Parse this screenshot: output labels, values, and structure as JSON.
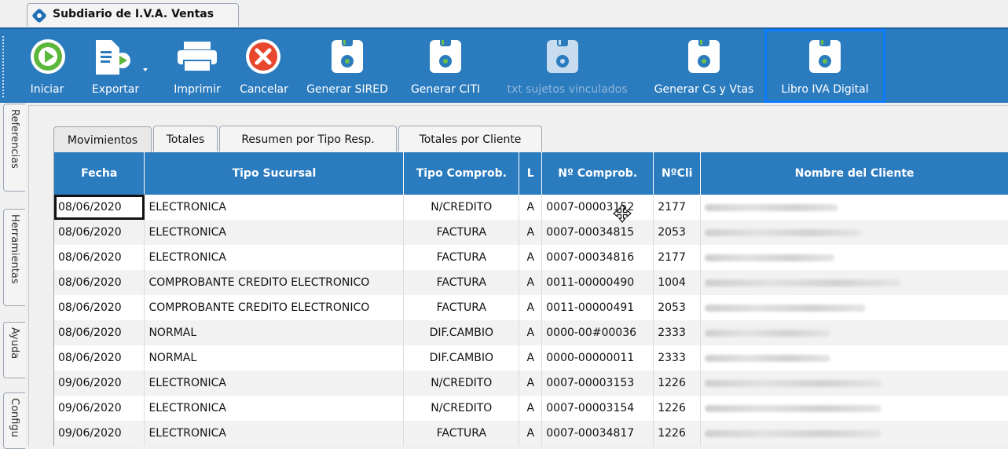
{
  "window": {
    "title": "Subdiario de I.V.A. Ventas"
  },
  "toolbar": {
    "iniciar": "Iniciar",
    "exportar": "Exportar",
    "imprimir": "Imprimir",
    "cancelar": "Cancelar",
    "generar_sired": "Generar SIRED",
    "generar_citi": "Generar CITI",
    "txt_sujetos": "txt sujetos vinculados",
    "generar_cs_vtas": "Generar Cs y Vtas",
    "libro_iva": "Libro IVA Digital"
  },
  "side_tabs": [
    "Referencias",
    "Herramientas",
    "Ayuda",
    "Configu"
  ],
  "tabs": [
    "Movimientos",
    "Totales",
    "Resumen por Tipo Resp.",
    "Totales por Cliente"
  ],
  "grid": {
    "columns": [
      "Fecha",
      "Tipo Sucursal",
      "Tipo Comprob.",
      "L",
      "Nº Comprob.",
      "NºCli",
      "Nombre del Cliente"
    ],
    "rows": [
      {
        "fecha": "08/06/2020",
        "sucursal": "ELECTRONICA",
        "tipo": "N/CREDITO",
        "l": "A",
        "nro": "0007-00003152",
        "cli": "2177"
      },
      {
        "fecha": "08/06/2020",
        "sucursal": "ELECTRONICA",
        "tipo": "FACTURA",
        "l": "A",
        "nro": "0007-00034815",
        "cli": "2053"
      },
      {
        "fecha": "08/06/2020",
        "sucursal": "ELECTRONICA",
        "tipo": "FACTURA",
        "l": "A",
        "nro": "0007-00034816",
        "cli": "2177"
      },
      {
        "fecha": "08/06/2020",
        "sucursal": "COMPROBANTE CREDITO ELECTRONICO",
        "tipo": "FACTURA",
        "l": "A",
        "nro": "0011-00000490",
        "cli": "1004"
      },
      {
        "fecha": "08/06/2020",
        "sucursal": "COMPROBANTE CREDITO ELECTRONICO",
        "tipo": "FACTURA",
        "l": "A",
        "nro": "0011-00000491",
        "cli": "2053"
      },
      {
        "fecha": "08/06/2020",
        "sucursal": "NORMAL",
        "tipo": "DIF.CAMBIO",
        "l": "A",
        "nro": "0000-00#00036",
        "cli": "2333"
      },
      {
        "fecha": "08/06/2020",
        "sucursal": "NORMAL",
        "tipo": "DIF.CAMBIO",
        "l": "A",
        "nro": "0000-00000011",
        "cli": "2333"
      },
      {
        "fecha": "09/06/2020",
        "sucursal": "ELECTRONICA",
        "tipo": "N/CREDITO",
        "l": "A",
        "nro": "0007-00003153",
        "cli": "1226"
      },
      {
        "fecha": "09/06/2020",
        "sucursal": "ELECTRONICA",
        "tipo": "N/CREDITO",
        "l": "A",
        "nro": "0007-00003154",
        "cli": "1226"
      },
      {
        "fecha": "09/06/2020",
        "sucursal": "ELECTRONICA",
        "tipo": "FACTURA",
        "l": "A",
        "nro": "0007-00034817",
        "cli": "1226"
      }
    ]
  },
  "colors": {
    "accent": "#2b7bbf",
    "highlight": "#0a7bff",
    "arrow": "#1f7ae0"
  },
  "icons": {
    "iniciar": "play-icon",
    "exportar": "export-icon",
    "imprimir": "printer-icon",
    "cancelar": "cancel-icon",
    "disk": "floppy-disk-icon"
  }
}
